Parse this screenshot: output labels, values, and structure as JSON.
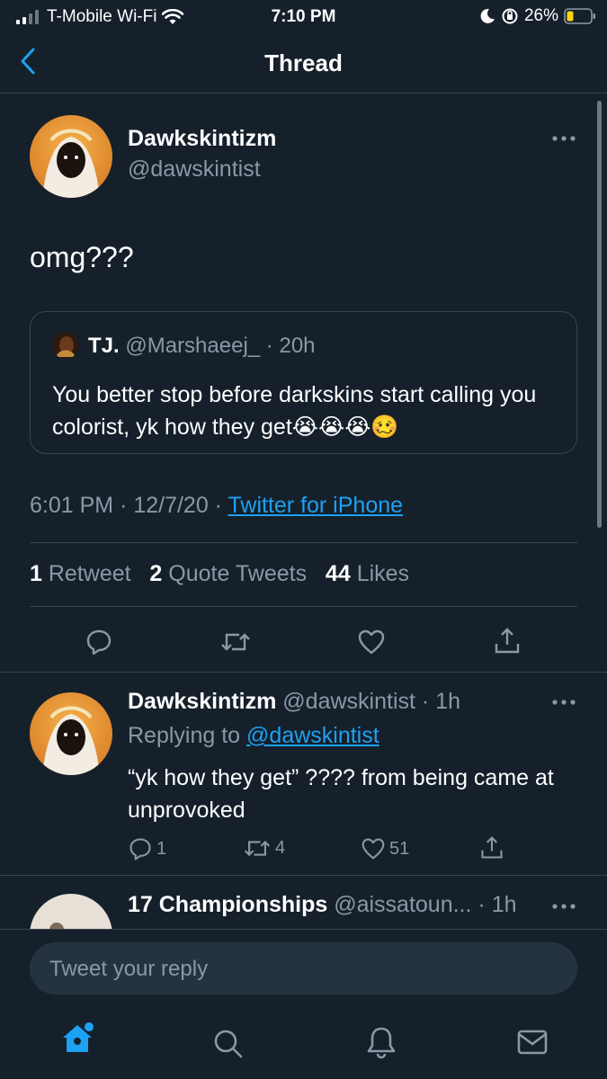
{
  "status_bar": {
    "carrier": "T-Mobile Wi-Fi",
    "time": "7:10 PM",
    "battery": "26%"
  },
  "header": {
    "title": "Thread",
    "back_icon": "chevron-left-icon"
  },
  "main_tweet": {
    "display_name": "Dawkskintizm",
    "handle": "@dawskintist",
    "text": "omg???",
    "more_icon": "more-horizontal-icon",
    "quoted": {
      "display_name": "TJ.",
      "handle": "@Marshaeej_",
      "separator": "·",
      "time": "20h",
      "text": "You better stop before darkskins start calling you colorist, yk how they get😭😭😭🥴"
    },
    "timestamp": "6:01 PM · 12/7/20 · ",
    "source": "Twitter for iPhone",
    "stats": {
      "retweets_count": "1",
      "retweets_label": "Retweet",
      "quotes_count": "2",
      "quotes_label": "Quote Tweets",
      "likes_count": "44",
      "likes_label": "Likes"
    }
  },
  "replies": [
    {
      "display_name": "Dawkskintizm",
      "handle": "@dawskintist",
      "time": "· 1h",
      "replying_prefix": "Replying to ",
      "replying_to": "@dawskintist",
      "text": "“yk how they get” ???? from being came at unprovoked",
      "reply_count": "1",
      "retweet_count": "4",
      "like_count": "51"
    },
    {
      "display_name": "17 Championships",
      "handle": "@aissatoun...",
      "time": "· 1h"
    }
  ],
  "compose": {
    "placeholder": "Tweet your reply"
  },
  "tabbar": {
    "items": [
      "home-icon",
      "search-icon",
      "notifications-icon",
      "messages-icon"
    ]
  },
  "colors": {
    "background": "#15202b",
    "accent": "#1da1f2",
    "muted": "#8b98a5",
    "divider": "#38444d"
  }
}
